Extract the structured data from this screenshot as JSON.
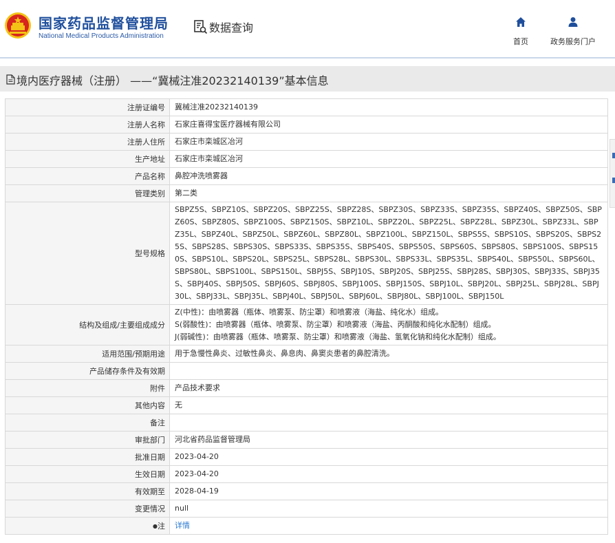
{
  "header": {
    "logo_cn": "国家药品监督管理局",
    "logo_en": "National Medical Products Administration",
    "query_label": "数据查询",
    "nav": [
      {
        "label": "首页",
        "icon": "home-icon"
      },
      {
        "label": "政务服务门户",
        "icon": "user-icon"
      }
    ]
  },
  "colors": {
    "brand_blue": "#1f4f9c",
    "link_blue": "#2a7ad2",
    "emblem_red": "#d7261e",
    "emblem_gold": "#f3c316"
  },
  "page": {
    "title": "境内医疗器械（注册） ——“冀械注准20232140139”基本信息"
  },
  "record": {
    "rows": [
      {
        "label": "注册证编号",
        "value": "冀械注准20232140139"
      },
      {
        "label": "注册人名称",
        "value": "石家庄喜得宝医疗器械有限公司"
      },
      {
        "label": "注册人住所",
        "value": "石家庄市栾城区冶河"
      },
      {
        "label": "生产地址",
        "value": "石家庄市栾城区冶河"
      },
      {
        "label": "产品名称",
        "value": "鼻腔冲洗喷雾器"
      },
      {
        "label": "管理类别",
        "value": "第二类"
      },
      {
        "label": "型号规格",
        "value": "SBPZ5S、SBPZ10S、SBPZ20S、SBPZ25S、SBPZ28S、SBPZ30S、SBPZ33S、SBPZ35S、SBPZ40S、SBPZ50S、SBPZ60S、SBPZ80S、SBPZ100S、SBPZ150S、SBPZ10L、SBPZ20L、SBPZ25L、SBPZ28L、SBPZ30L、SBPZ33L、SBPZ35L、SBPZ40L、SBPZ50L、SBPZ60L、SBPZ80L、SBPZ100L、SBPZ150L、SBPS5S、SBPS10S、SBPS20S、SBPS25S、SBPS28S、SBPS30S、SBPS33S、SBPS35S、SBPS40S、SBPS50S、SBPS60S、SBPS80S、SBPS100S、SBPS150S、SBPS10L、SBPS20L、SBPS25L、SBPS28L、SBPS30L、SBPS33L、SBPS35L、SBPS40L、SBPS50L、SBPS60L、SBPS80L、SBPS100L、SBPS150L、SBPJ5S、SBPJ10S、SBPJ20S、SBPJ25S、SBPJ28S、SBPJ30S、SBPJ33S、SBPJ35S、SBPJ40S、SBPJ50S、SBPJ60S、SBPJ80S、SBPJ100S、SBPJ150S、SBPJ10L、SBPJ20L、SBPJ25L、SBPJ28L、SBPJ30L、SBPJ33L、SBPJ35L、SBPJ40L、SBPJ50L、SBPJ60L、SBPJ80L、SBPJ100L、SBPJ150L"
      },
      {
        "label": "结构及组成/主要组成成分",
        "lines": [
          "Z(中性)：由喷雾器（瓶体、喷雾泵、防尘罩）和喷雾液（海盐、纯化水）组成。",
          "S(弱酸性)：由喷雾器（瓶体、喷雾泵、防尘罩）和喷雾液（海盐、丙酮酸和纯化水配制）组成。",
          "J(弱碱性)：由喷雾器（瓶体、喷雾泵、防尘罩）和喷雾液（海盐、氢氧化钠和纯化水配制）组成。"
        ]
      },
      {
        "label": "适用范围/预期用途",
        "value": "用于急慢性鼻炎、过敏性鼻炎、鼻息肉、鼻窦炎患者的鼻腔清洗。"
      },
      {
        "label": "产品储存条件及有效期",
        "value": ""
      },
      {
        "label": "附件",
        "value": "产品技术要求"
      },
      {
        "label": "其他内容",
        "value": "无"
      },
      {
        "label": "备注",
        "value": ""
      },
      {
        "label": "审批部门",
        "value": "河北省药品监督管理局"
      },
      {
        "label": "批准日期",
        "value": "2023-04-20"
      },
      {
        "label": "生效日期",
        "value": "2023-04-20"
      },
      {
        "label": "有效期至",
        "value": "2028-04-19"
      },
      {
        "label": "变更情况",
        "value": "null"
      },
      {
        "label": "注",
        "value": "详情",
        "marker": "●"
      }
    ]
  }
}
